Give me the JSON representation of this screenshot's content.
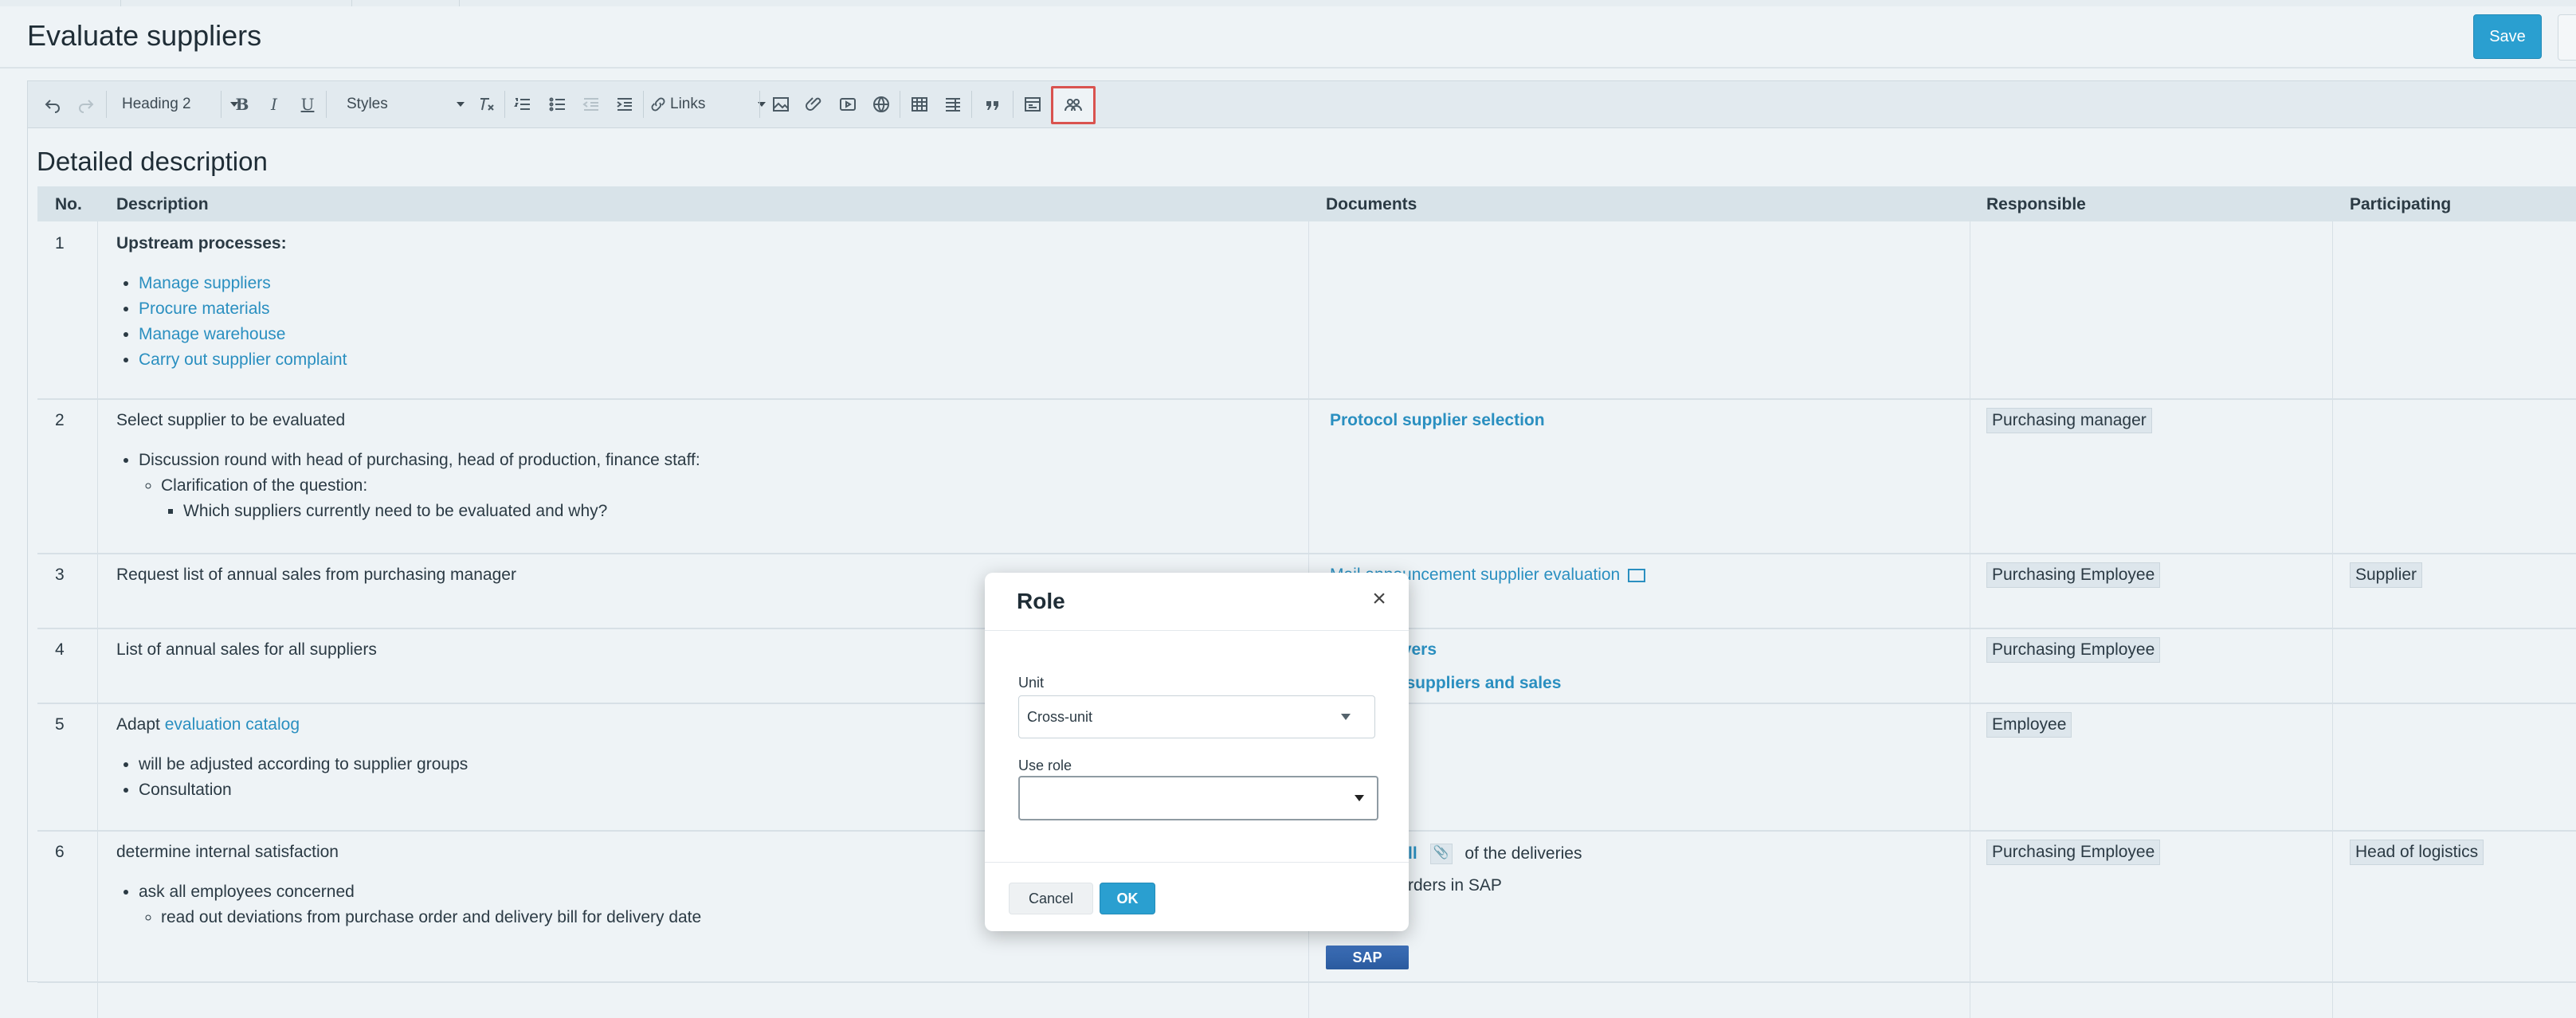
{
  "header": {
    "title": "Evaluate suppliers",
    "save_label": "Save"
  },
  "toolbar": {
    "heading_select": "Heading 2",
    "styles_select": "Styles",
    "links_select": "Links",
    "bold": "B",
    "italic": "I",
    "underline": "U",
    "icons": [
      "undo-icon",
      "redo-icon",
      "clear-format-icon",
      "numbered-list-icon",
      "bullet-list-icon",
      "outdent-icon",
      "indent-icon",
      "link-icon",
      "image-icon",
      "attachment-icon",
      "video-icon",
      "globe-icon",
      "table-icon",
      "table-properties-icon",
      "blockquote-icon",
      "template-icon",
      "role-icon"
    ]
  },
  "content": {
    "section_heading": "Detailed description",
    "columns": [
      "No.",
      "Description",
      "Documents",
      "Responsible",
      "Participating"
    ],
    "rows": [
      {
        "no": "1",
        "desc_title": "Upstream processes:",
        "links": [
          "Manage suppliers",
          "Procure materials",
          "Manage warehouse",
          "Carry out supplier complaint"
        ]
      },
      {
        "no": "2",
        "desc": "Select supplier to be evaluated",
        "b1": "Discussion round with head of purchasing, head of production, finance staff:",
        "b2": "Clarification of the question:",
        "b3": "Which suppliers currently need to be evaluated and why?",
        "doc": "Protocol supplier selection",
        "responsible": "Purchasing manager"
      },
      {
        "no": "3",
        "desc": "Request list of annual sales from purchasing manager",
        "doc": "Mail announcement supplier evaluation",
        "doc_partial": "Mail announcement supplier evaluation",
        "doc2_partial": "s",
        "responsible": "Purchasing Employee",
        "participating": "Supplier"
      },
      {
        "no": "4",
        "desc": "List of annual sales for all suppliers",
        "doc_partial": "overs",
        "doc2_partial": "ll suppliers and sales",
        "responsible": "Purchasing Employee"
      },
      {
        "no": "5",
        "desc_prefix": "Adapt ",
        "desc_link": "evaluation catalog",
        "b1": "will be adjusted according to supplier groups",
        "b2": "Consultation",
        "responsible": "Employee"
      },
      {
        "no": "6",
        "desc": "determine internal satisfaction",
        "b1": "ask all employees concerned",
        "b2": "read out deviations from purchase order and delivery bill for delivery date",
        "doc_partial": "ll",
        "doc_suffix": "of the deliveries",
        "doc2_partial": "rders in SAP",
        "sap_label": "SAP",
        "responsible": "Purchasing Employee",
        "participating": "Head of logistics"
      }
    ]
  },
  "modal": {
    "title": "Role",
    "unit_label": "Unit",
    "unit_value": "Cross-unit",
    "use_role_label": "Use role",
    "use_role_value": "",
    "cancel_label": "Cancel",
    "ok_label": "OK"
  },
  "colors": {
    "accent": "#2a9fd0",
    "link": "#2a8fc0",
    "highlight_border": "#d9534f"
  }
}
